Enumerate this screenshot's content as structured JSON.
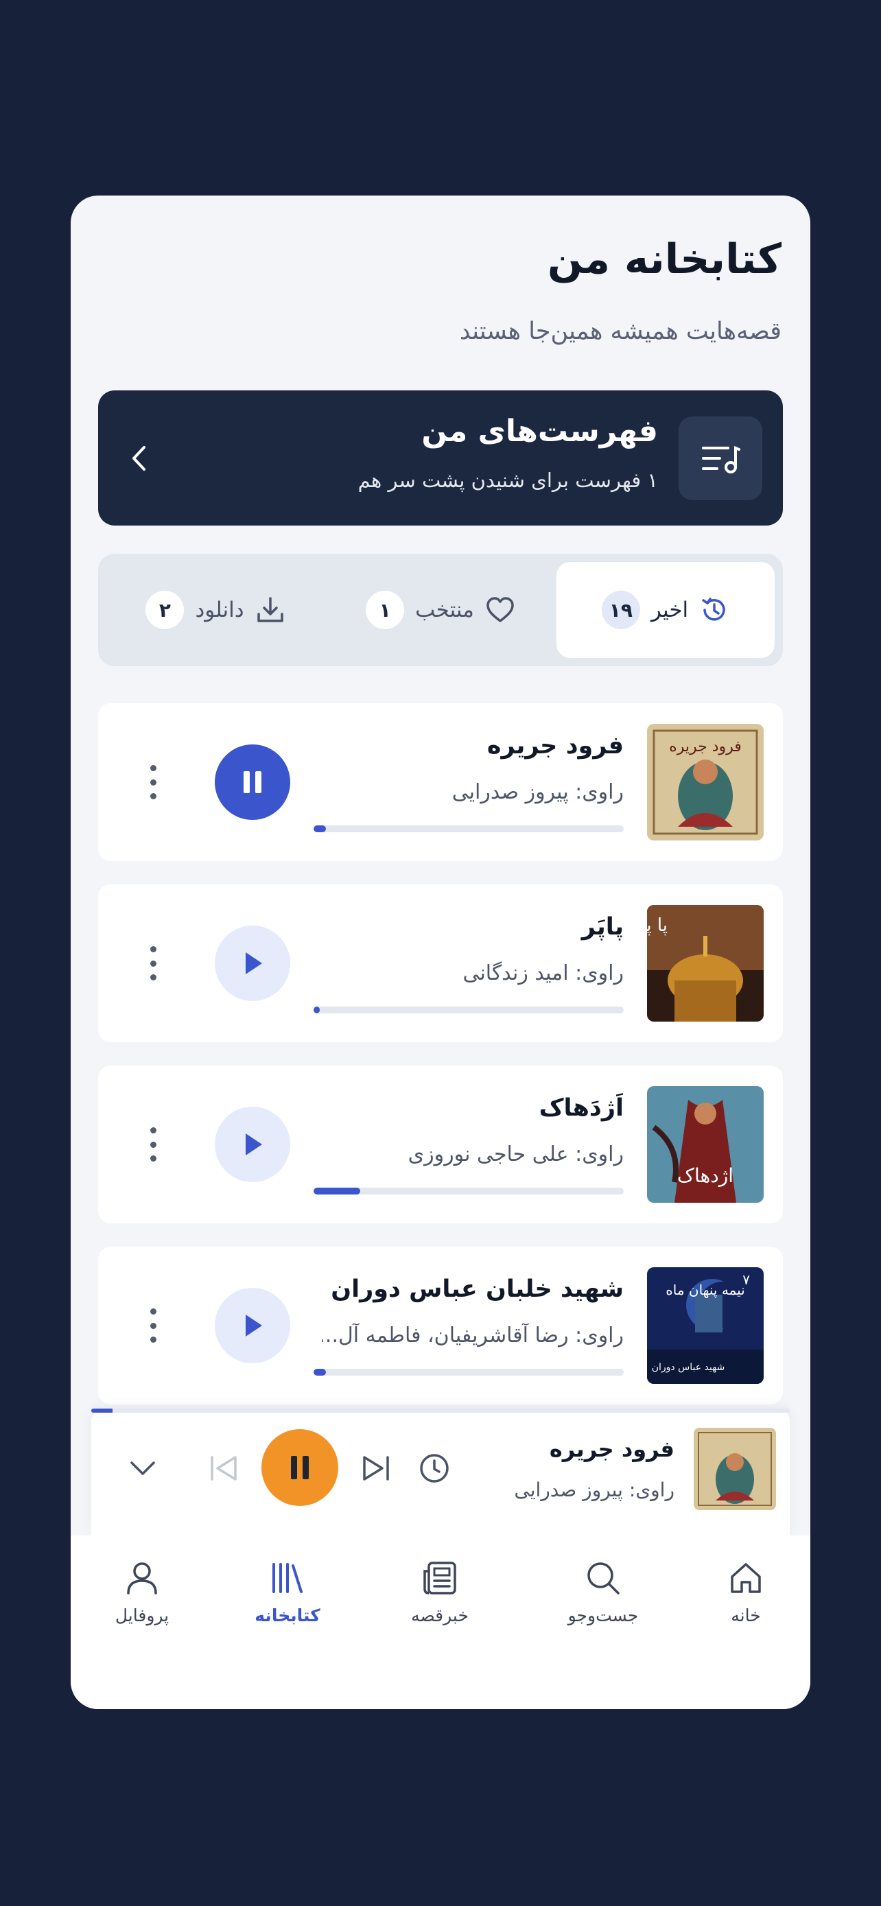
{
  "header": {
    "title": "کتابخانه من",
    "subtitle": "قصه‌هایت همیشه همین‌جا هستند"
  },
  "playlists": {
    "title": "فهرست‌های من",
    "subtitle": "۱ فهرست برای شنیدن پشت سر هم",
    "icon": "playlist-icon"
  },
  "tabs": [
    {
      "label": "اخیر",
      "count": "۱۹",
      "icon": "history-icon",
      "active": true
    },
    {
      "label": "منتخب",
      "count": "۱",
      "icon": "heart-icon",
      "active": false
    },
    {
      "label": "دانلود",
      "count": "۲",
      "icon": "download-icon",
      "active": false
    }
  ],
  "books": [
    {
      "title": "فرود جریره",
      "narrator": "راوی: پیروز صدرایی",
      "progress": 0.04,
      "state": "playing"
    },
    {
      "title": "پاپَر",
      "narrator": "راوی: امید زندگانی",
      "progress": 0.02,
      "state": "paused"
    },
    {
      "title": "اَژدَهاک",
      "narrator": "راوی: علی حاجی نوروزی",
      "progress": 0.15,
      "state": "paused"
    },
    {
      "title": "شهید خلبان عباس دوران",
      "narrator": "راوی: رضا آقاشریفیان، فاطمه آل...",
      "progress": 0.04,
      "state": "paused"
    }
  ],
  "covers": {
    "book1_text": "فرود جریره",
    "book2_text": "پا پر",
    "book3_text": "اژدهاک",
    "book4_text": "نیمه پنهان ماه",
    "book4_caption": "شهید عباس دوران",
    "book4_number": "۷"
  },
  "mini_player": {
    "title": "فرود جریره",
    "narrator": "راوی: پیروز صدرایی",
    "progress": 0.03
  },
  "nav": [
    {
      "label": "خانه",
      "icon": "home-icon",
      "active": false
    },
    {
      "label": "جست‌وجو",
      "icon": "search-icon",
      "active": false
    },
    {
      "label": "خبرقصه",
      "icon": "news-icon",
      "active": false
    },
    {
      "label": "کتابخانه",
      "icon": "library-icon",
      "active": true
    },
    {
      "label": "پروفایل",
      "icon": "profile-icon",
      "active": false
    }
  ],
  "colors": {
    "background": "#17223a",
    "accent": "#3b55cc",
    "orange": "#f29327",
    "dark_card": "#1c2840"
  }
}
